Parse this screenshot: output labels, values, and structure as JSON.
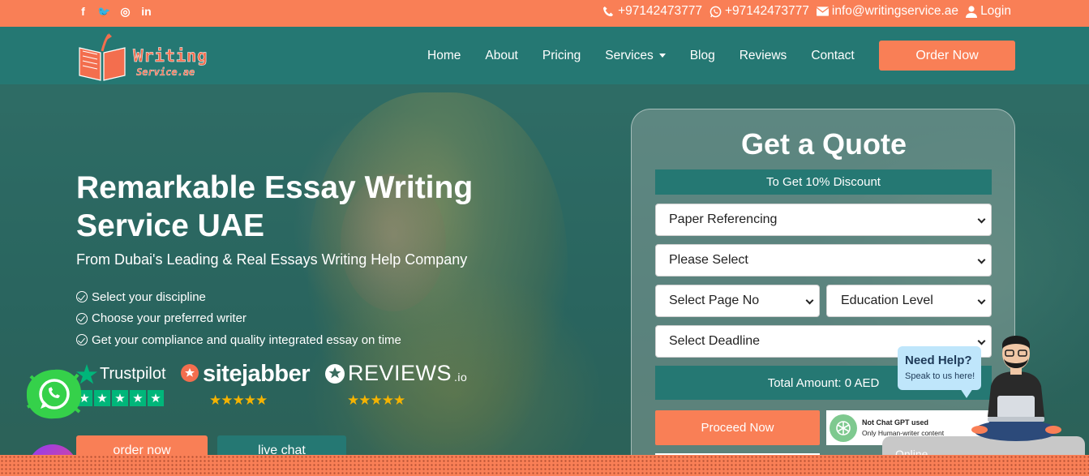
{
  "topbar": {
    "social": [
      {
        "icon": "facebook-icon",
        "glyph": "f"
      },
      {
        "icon": "twitter-icon",
        "glyph": "🐦"
      },
      {
        "icon": "instagram-icon",
        "glyph": "◎"
      },
      {
        "icon": "linkedin-icon",
        "glyph": "in"
      }
    ],
    "phone": "+97142473777",
    "whatsapp": "+97142473777",
    "email": "info@writingservice.ae",
    "login": "Login"
  },
  "logo": {
    "line1": "Writing",
    "line2": "Service.ae"
  },
  "nav": {
    "items": [
      "Home",
      "About",
      "Pricing",
      "Services",
      "Blog",
      "Reviews",
      "Contact"
    ],
    "order": "Order Now"
  },
  "hero": {
    "title": "Remarkable Essay Writing Service UAE",
    "subtitle": "From Dubai's Leading & Real Essays Writing Help Company",
    "checks": [
      "Select your discipline",
      "Choose your preferred writer",
      "Get your compliance and quality integrated essay on time"
    ],
    "reviews": {
      "trustpilot": "Trustpilot",
      "sitejabber": "sitejabber",
      "reviews_io": "REVIEWS",
      "reviews_io_suffix": ".io",
      "stars": "★★★★★",
      "tp_star": "★"
    },
    "order_btn": "order now",
    "chat_btn": "live chat"
  },
  "quote": {
    "title": "Get a Quote",
    "discount": "To Get 10% Discount",
    "referencing": "Paper Referencing",
    "please_select": "Please Select",
    "page_no": "Select Page No",
    "education": "Education Level",
    "deadline": "Select Deadline",
    "total": "Total Amount: 0 AED",
    "proceed": "Proceed Now",
    "gpt_title": "Not Chat GPT used",
    "gpt_sub": "Only Human-writer content"
  },
  "help": {
    "title": "Need Help?",
    "sub": "Speak to us here!",
    "status": "Online"
  },
  "colors": {
    "accent": "#f97f56",
    "teal": "#257873",
    "star": "#f5b301",
    "trustpilot": "#00b67a"
  }
}
